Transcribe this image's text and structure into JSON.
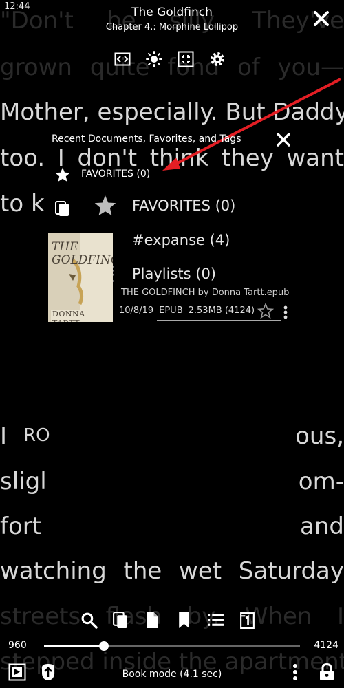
{
  "status_bar": {
    "time": "12:44"
  },
  "header": {
    "title": "The Goldfinch",
    "subtitle": "Chapter 4.: Morphine Lollipop"
  },
  "top_toolbar": {
    "icons": [
      "fit-width-icon",
      "brightness-icon",
      "fullscreen-exit-icon",
      "settings-icon"
    ]
  },
  "background_text": {
    "line1": "\"Don't be silly. They've",
    "line2": "grown quite fond of you—",
    "line3": "Mother, especially. But Daddy,",
    "line4": "too. I don't think they want",
    "line5": "to k",
    "line6a": "I",
    "line6b": "RO",
    "line6c": "ous,",
    "line7a": "sligl",
    "line7c": "om-",
    "line8a": "fort",
    "line8c": "and",
    "line9": "watching the wet Saturday",
    "line10": "streets flash by. When I",
    "line11": "stepped inside the apartment"
  },
  "popup": {
    "title": "Recent Documents, Favorites, and Tags",
    "favorites_link": "FAVORITES (0)",
    "menu": [
      {
        "icon": "star-icon",
        "label": "FAVORITES (0)"
      },
      {
        "icon": "pencil-icon",
        "label": "#expanse (4)"
      },
      {
        "icon": "playlist-icon",
        "label": "Playlists (0)"
      }
    ]
  },
  "book_entry": {
    "file_name": "THE GOLDFINCH by Donna Tartt.epub",
    "date": "10/8/19",
    "format": "EPUB",
    "size": "2.53MB (4124)",
    "cover": {
      "title": "THE GOLDFINCH",
      "author": "DONNA TARTT"
    }
  },
  "bottom": {
    "page_current": "960",
    "page_total": "4124",
    "progress": 0.233,
    "mode": "Book mode (4.1 sec)"
  },
  "colors": {
    "accent_red": "#e31e24",
    "background": "#000000"
  }
}
